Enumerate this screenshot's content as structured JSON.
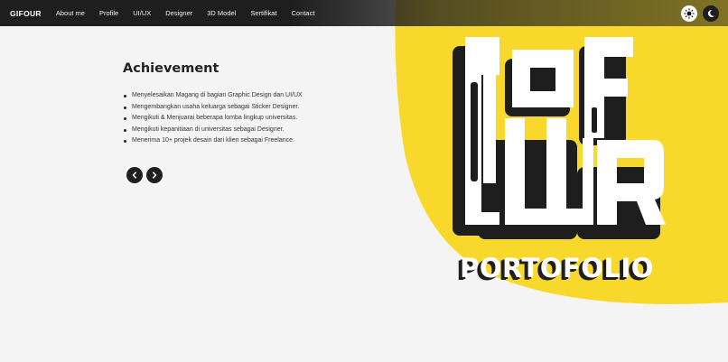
{
  "nav": {
    "brand": "GIFOUR",
    "links": [
      "About me",
      "Profile",
      "UI/UX",
      "Designer",
      "3D Model",
      "Sertifikat",
      "Contact"
    ]
  },
  "theme": {
    "light_icon": "sun-icon",
    "dark_icon": "moon-icon"
  },
  "achievement": {
    "title": "Achievement",
    "items": [
      "Menyelesaikan Magang di bagian Graphic Design dan UI/UX",
      "Mengembangkan usaha keluarga sebagai Sticker Designer.",
      "Mengikuti & Menjuarai beberapa lomba lingkup universitas.",
      "Mengikuti kepanitiaan di universitas sebagai Designer.",
      "Menerima 10+ projek desain dari klien sebagai Freelance."
    ]
  },
  "carousel": {
    "prev_icon": "chevron-left-icon",
    "next_icon": "chevron-right-icon"
  },
  "logo": {
    "word": "GIFOUR",
    "caption": "PORTOFOLIO"
  },
  "colors": {
    "accent": "#f8d92b",
    "dark": "#1e1e1e",
    "background": "#f4f4f4"
  }
}
